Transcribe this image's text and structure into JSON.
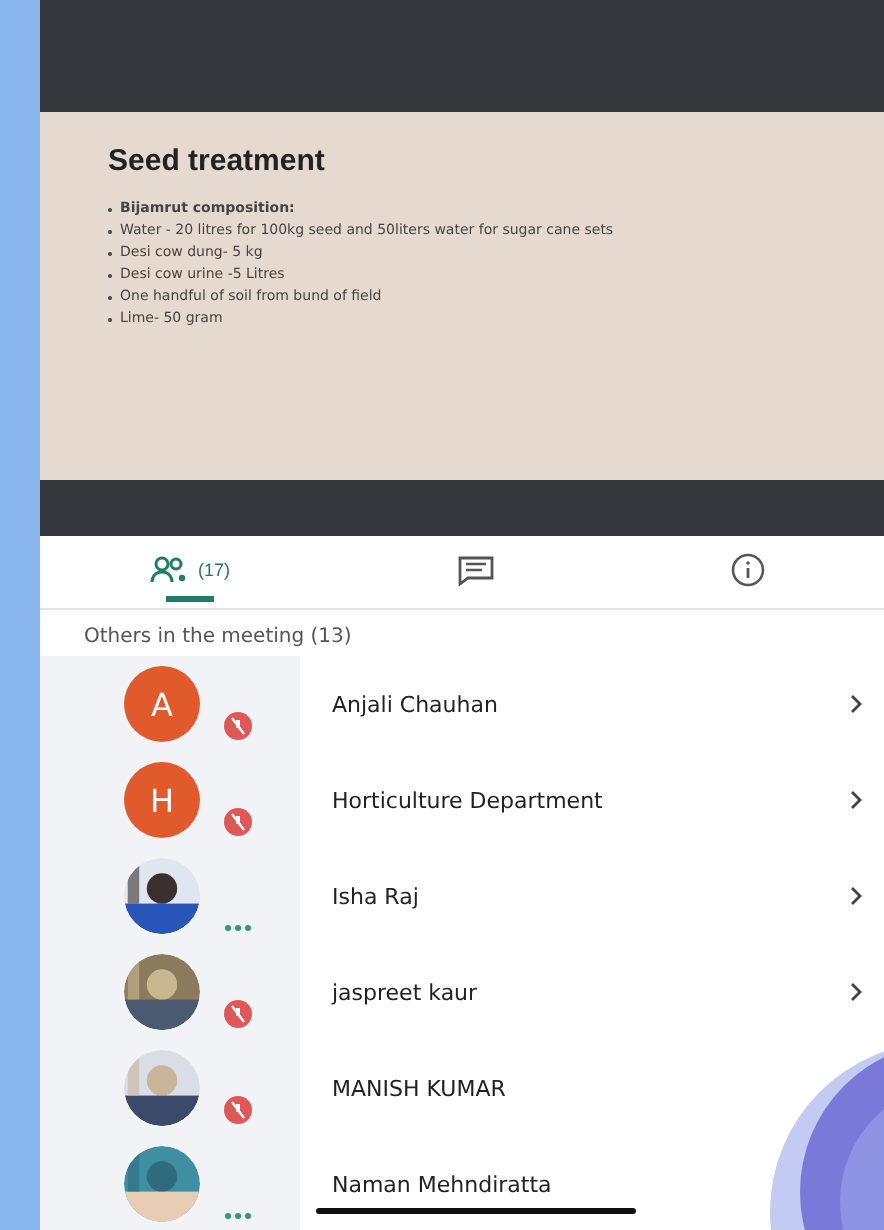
{
  "slide": {
    "title": "Seed treatment",
    "bullets": [
      {
        "text": "**Bijamrut composition:**"
      },
      {
        "text": "Water - 20 litres for 100kg seed and 50liters water for sugar cane sets"
      },
      {
        "text": "Desi cow dung- 5 kg"
      },
      {
        "text": "Desi cow urine -5 Litres"
      },
      {
        "text": "One handful of soil from bund of field"
      },
      {
        "text": "Lime- 50 gram"
      }
    ]
  },
  "tabs": [
    {
      "kind": "people",
      "label": "(17)",
      "selected": true
    },
    {
      "kind": "chat",
      "selected": false
    },
    {
      "kind": "info",
      "selected": false
    }
  ],
  "section_title": "Others in the meeting (13)",
  "participants": [
    {
      "name": "Anjali Chauhan",
      "avatar": {
        "kind": "letter",
        "letter": "A"
      },
      "muted": true,
      "chevron": true
    },
    {
      "name": "Horticulture Department",
      "avatar": {
        "kind": "letter",
        "letter": "H"
      },
      "muted": true,
      "chevron": true
    },
    {
      "name": "Isha Raj",
      "muted": false,
      "chevron": true
    },
    {
      "name": "jaspreet kaur",
      "muted": true,
      "chevron": true
    },
    {
      "name": "MANISH KUMAR",
      "muted": true,
      "chevron": false
    },
    {
      "name": "Naman Mehndiratta",
      "muted": false,
      "chevron": false
    }
  ]
}
